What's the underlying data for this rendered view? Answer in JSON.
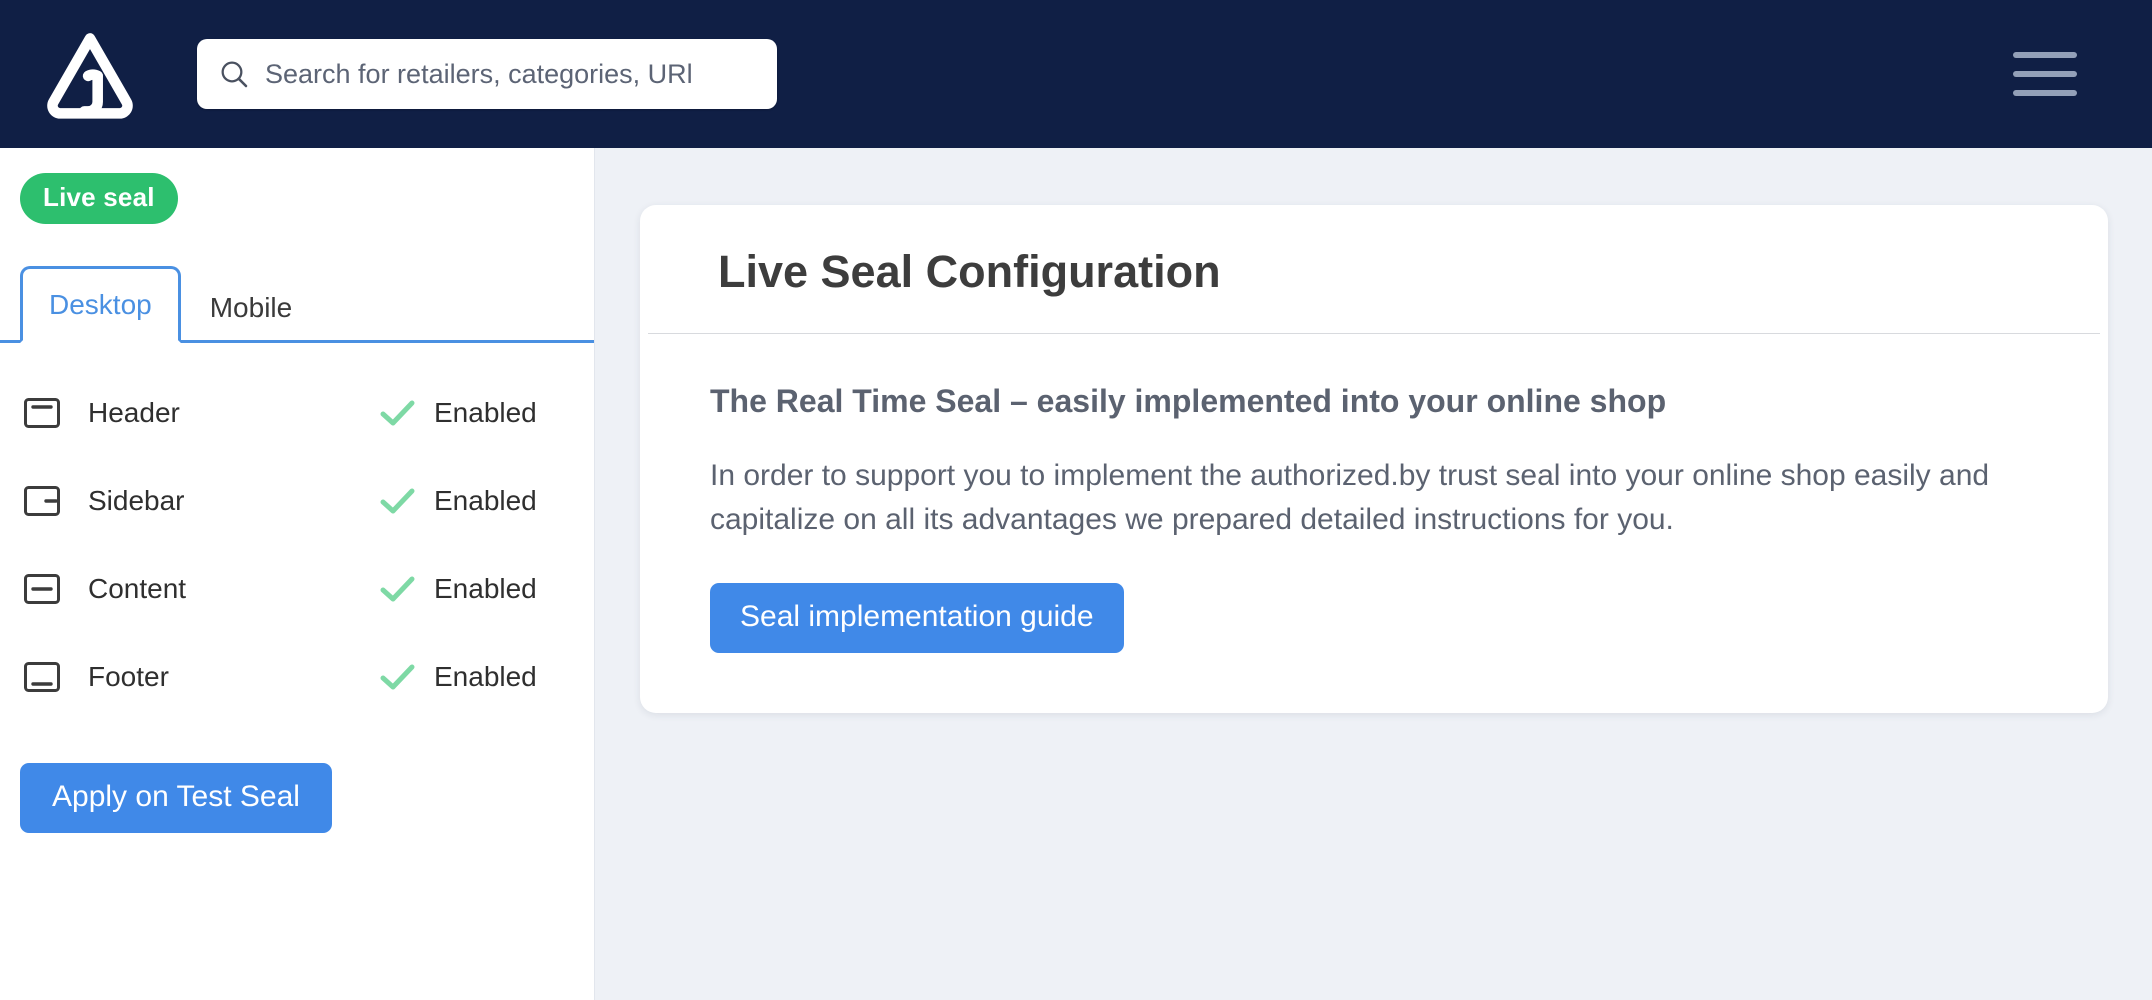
{
  "navbar": {
    "logo_name": "authorized-by-logo",
    "search": {
      "placeholder": "Search for retailers, categories, URl",
      "value": "",
      "icon": "search-icon"
    },
    "menu_icon": "hamburger-menu-icon",
    "background_color": "#101f45"
  },
  "sidebar": {
    "badge": {
      "label": "Live seal",
      "color": "#2dbf6e"
    },
    "tabs": [
      {
        "label": "Desktop",
        "active": true
      },
      {
        "label": "Mobile",
        "active": false
      }
    ],
    "active_tab_color": "#4a90e2",
    "features": [
      {
        "label": "Header",
        "status": "Enabled",
        "icon": "layout-header-icon"
      },
      {
        "label": "Sidebar",
        "status": "Enabled",
        "icon": "layout-sidebar-icon"
      },
      {
        "label": "Content",
        "status": "Enabled",
        "icon": "layout-content-icon"
      },
      {
        "label": "Footer",
        "status": "Enabled",
        "icon": "layout-footer-icon"
      }
    ],
    "check_color": "#7ed9a5",
    "apply_button": {
      "label": "Apply on Test Seal",
      "color": "#4089e8"
    }
  },
  "main": {
    "card": {
      "title": "Live Seal Configuration",
      "subtitle": "The Real Time Seal – easily implemented into your online shop",
      "paragraph": "In order to support you to implement the authorized.by trust seal into your online shop easily and capitalize on all its advantages we prepared detailed instructions for you.",
      "guide_button": {
        "label": "Seal implementation guide",
        "color": "#4089e8"
      }
    },
    "background_color": "#eef1f6"
  }
}
